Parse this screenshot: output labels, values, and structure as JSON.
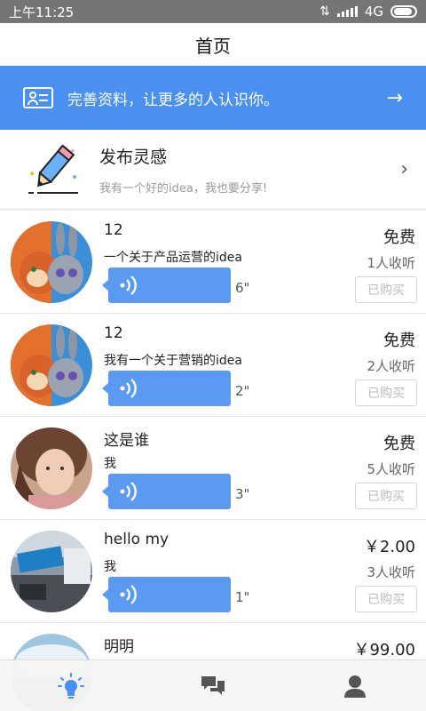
{
  "status_bar": {
    "time": "上午11:25",
    "network": "4G"
  },
  "nav": {
    "title": "首页"
  },
  "banner": {
    "text": "完善资料，让更多的人认识你。",
    "arrow": "→"
  },
  "publish": {
    "title": "发布灵感",
    "subtitle": "我有一个好的idea，我也要分享!",
    "chevron": "›"
  },
  "items": [
    {
      "title": "12",
      "desc": "一个关于产品运营的idea",
      "duration": "6\"",
      "price": "免费",
      "listeners": "1人收听",
      "bought": "已购买",
      "avatar": "zootopia-avatar"
    },
    {
      "title": "12",
      "desc": "我有一个关于营销的idea",
      "duration": "2\"",
      "price": "免费",
      "listeners": "2人收听",
      "bought": "已购买",
      "avatar": "zootopia-avatar"
    },
    {
      "title": "这是谁",
      "desc": "我",
      "duration": "3\"",
      "price": "免费",
      "listeners": "5人收听",
      "bought": "已购买",
      "avatar": "girl-portrait-avatar"
    },
    {
      "title": "hello my",
      "desc": "我",
      "duration": "1\"",
      "price": "￥2.00",
      "listeners": "3人收听",
      "bought": "已购买",
      "avatar": "street-photo-avatar"
    },
    {
      "title": "明明",
      "desc": "",
      "duration": "",
      "price": "￥99.00",
      "listeners": "",
      "bought": "",
      "avatar": "landscape-avatar"
    }
  ],
  "tabbar": {
    "tabs": [
      {
        "name": "inspiration",
        "icon": "lightbulb-icon",
        "active": true
      },
      {
        "name": "messages",
        "icon": "chat-bubbles-icon",
        "active": false
      },
      {
        "name": "profile",
        "icon": "person-icon",
        "active": false
      }
    ],
    "active_color": "#4a90f0",
    "inactive_color": "#555555"
  },
  "colors": {
    "accent": "#4a90f0",
    "voice": "#5a9af2"
  }
}
